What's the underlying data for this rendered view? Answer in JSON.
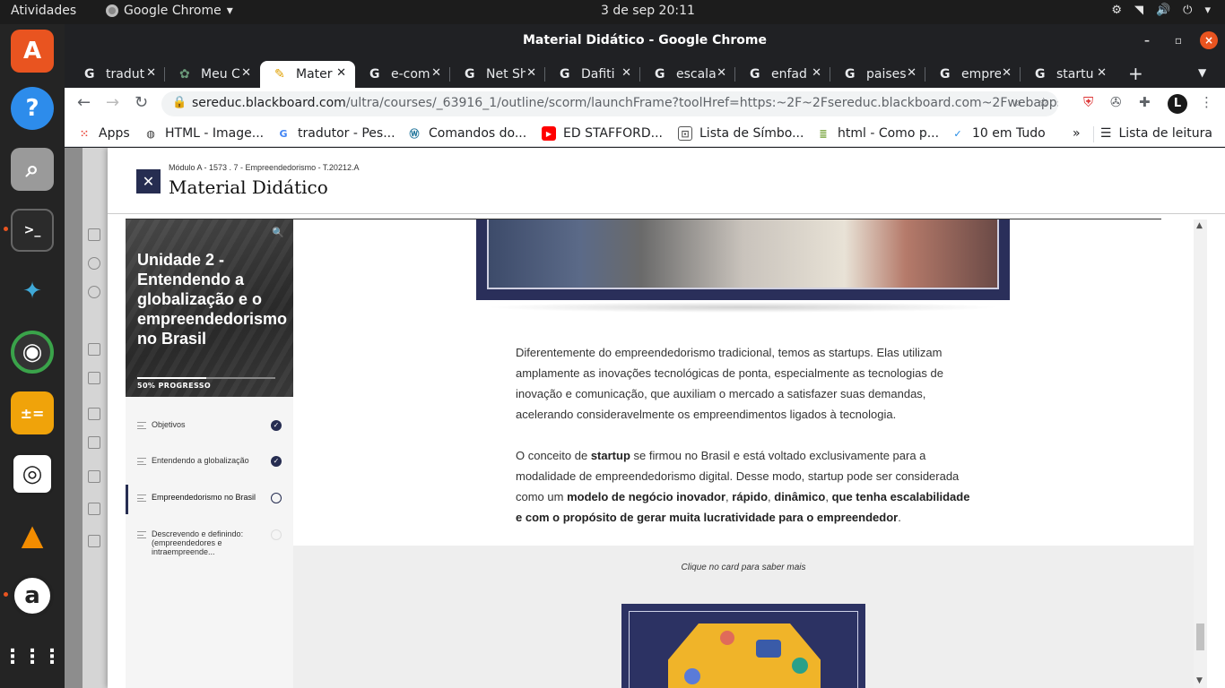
{
  "topbar": {
    "activities": "Atividades",
    "app_name": "Google Chrome",
    "clock": "3 de sep  20:11"
  },
  "window": {
    "title": "Material Didático - Google Chrome"
  },
  "tabs": [
    {
      "label": "tradut",
      "icon": "google-icon"
    },
    {
      "label": "Meu C",
      "icon": "app-icon"
    },
    {
      "label": "Mater",
      "icon": "pencil-icon",
      "active": true
    },
    {
      "label": "e-com",
      "icon": "google-icon"
    },
    {
      "label": "Net Sh",
      "icon": "google-icon"
    },
    {
      "label": "Dafiti",
      "icon": "google-icon"
    },
    {
      "label": "escala",
      "icon": "google-icon"
    },
    {
      "label": "enfad",
      "icon": "google-icon"
    },
    {
      "label": "paises",
      "icon": "google-icon"
    },
    {
      "label": "empre",
      "icon": "google-icon"
    },
    {
      "label": "startu",
      "icon": "google-icon"
    }
  ],
  "address": {
    "host": "sereduc.blackboard.com",
    "path": "/ultra/courses/_63916_1/outline/scorm/launchFrame?toolHref=https:~2F~2Fsereduc.blackboard.com~2Fwebapps~2F..."
  },
  "bookmarks": [
    {
      "label": "Apps"
    },
    {
      "label": "HTML - Image..."
    },
    {
      "label": "tradutor - Pes..."
    },
    {
      "label": "Comandos do..."
    },
    {
      "label": "ED STAFFORD..."
    },
    {
      "label": "Lista de Símbo..."
    },
    {
      "label": "html - Como p..."
    },
    {
      "label": "10 em Tudo"
    }
  ],
  "bookmarks_overflow": "»",
  "reading_list": "Lista de leitura",
  "course": {
    "breadcrumb": "Módulo A - 1573 . 7 - Empreendedorismo - T.20212.A",
    "title": "Material Didático"
  },
  "sidebar": {
    "unit_title": "Unidade 2 - Entendendo a globalização e o empreendedorismo no Brasil",
    "progress_label": "50% PROGRESSO",
    "progress_fraction": 0.5,
    "items": [
      {
        "label": "Objetivos",
        "status": "done"
      },
      {
        "label": "Entendendo a globalização",
        "status": "done"
      },
      {
        "label": "Empreendedorismo no Brasil",
        "status": "current"
      },
      {
        "label": "Descrevendo e definindo: (empreendedores e intraempreende...",
        "status": "locked"
      }
    ]
  },
  "content": {
    "para1": "Diferentemente do empreendedorismo tradicional, temos as startups. Elas utilizam amplamente as inovações tecnológicas de ponta, especialmente as tecnologias de inovação e comunicação, que auxiliam o mercado a satisfazer suas demandas, acelerando consideravelmente os empreendimentos ligados à tecnologia.",
    "para2": {
      "t1": "O conceito de ",
      "b1": "startup",
      "t2": " se firmou no Brasil e está voltado exclusivamente para a modalidade de empreendedorismo digital. Desse modo, startup pode ser considerada como um ",
      "b2": "modelo de negócio inovador",
      "t3": ", ",
      "b3": "rápido",
      "t4": ", ",
      "b4": "dinâmico",
      "t5": ", ",
      "b5": "que tenha escalabilidade e com o propósito de gerar muita lucratividade para o empreendedor",
      "t6": "."
    },
    "hint": "Clique no card para saber mais"
  },
  "colors": {
    "accent": "#262d51",
    "ubuntu_orange": "#e95420"
  }
}
